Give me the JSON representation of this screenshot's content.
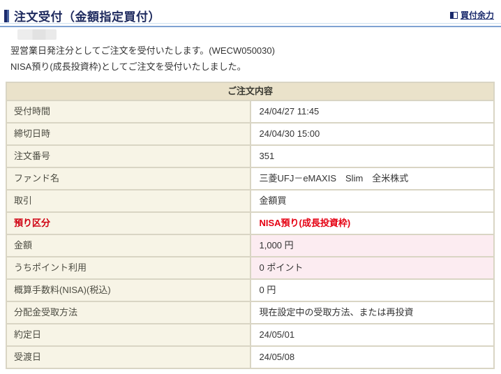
{
  "header": {
    "title": "注文受付（金額指定買付）",
    "link_label": "買付余力"
  },
  "messages": [
    "翌営業日発注分としてご注文を受付いたします。(WECW050030)",
    "NISA預り(成長投資枠)としてご注文を受付いたしました。"
  ],
  "order_table": {
    "caption": "ご注文内容",
    "rows": [
      {
        "label": "受付時間",
        "value": "24/04/27 11:45"
      },
      {
        "label": "締切日時",
        "value": "24/04/30 15:00"
      },
      {
        "label": "注文番号",
        "value": "351"
      },
      {
        "label": "ファンド名",
        "value": "三菱UFJ－eMAXIS　Slim　全米株式"
      },
      {
        "label": "取引",
        "value": "金額買"
      },
      {
        "label": "預り区分",
        "value": "NISA預り(成長投資枠)",
        "emphasis": "red"
      },
      {
        "label": "金額",
        "value": "1,000 円",
        "highlight": "pink"
      },
      {
        "label": "うちポイント利用",
        "value": "0 ポイント",
        "highlight": "pink"
      },
      {
        "label": "概算手数料(NISA)(税込)",
        "value": "0 円"
      },
      {
        "label": "分配金受取方法",
        "value": "現在設定中の受取方法、または再投資"
      },
      {
        "label": "約定日",
        "value": "24/05/01"
      },
      {
        "label": "受渡日",
        "value": "24/05/08"
      }
    ]
  },
  "colors": {
    "title_navy": "#1e2a5e",
    "link_navy": "#1a2a6c",
    "rule_blue": "#7fa2d2",
    "table_border": "#d9d5c4",
    "caption_bg": "#eae2ca",
    "label_bg": "#f7f4e6",
    "pink_bg": "#fcecf1",
    "alert_red": "#e50012"
  }
}
